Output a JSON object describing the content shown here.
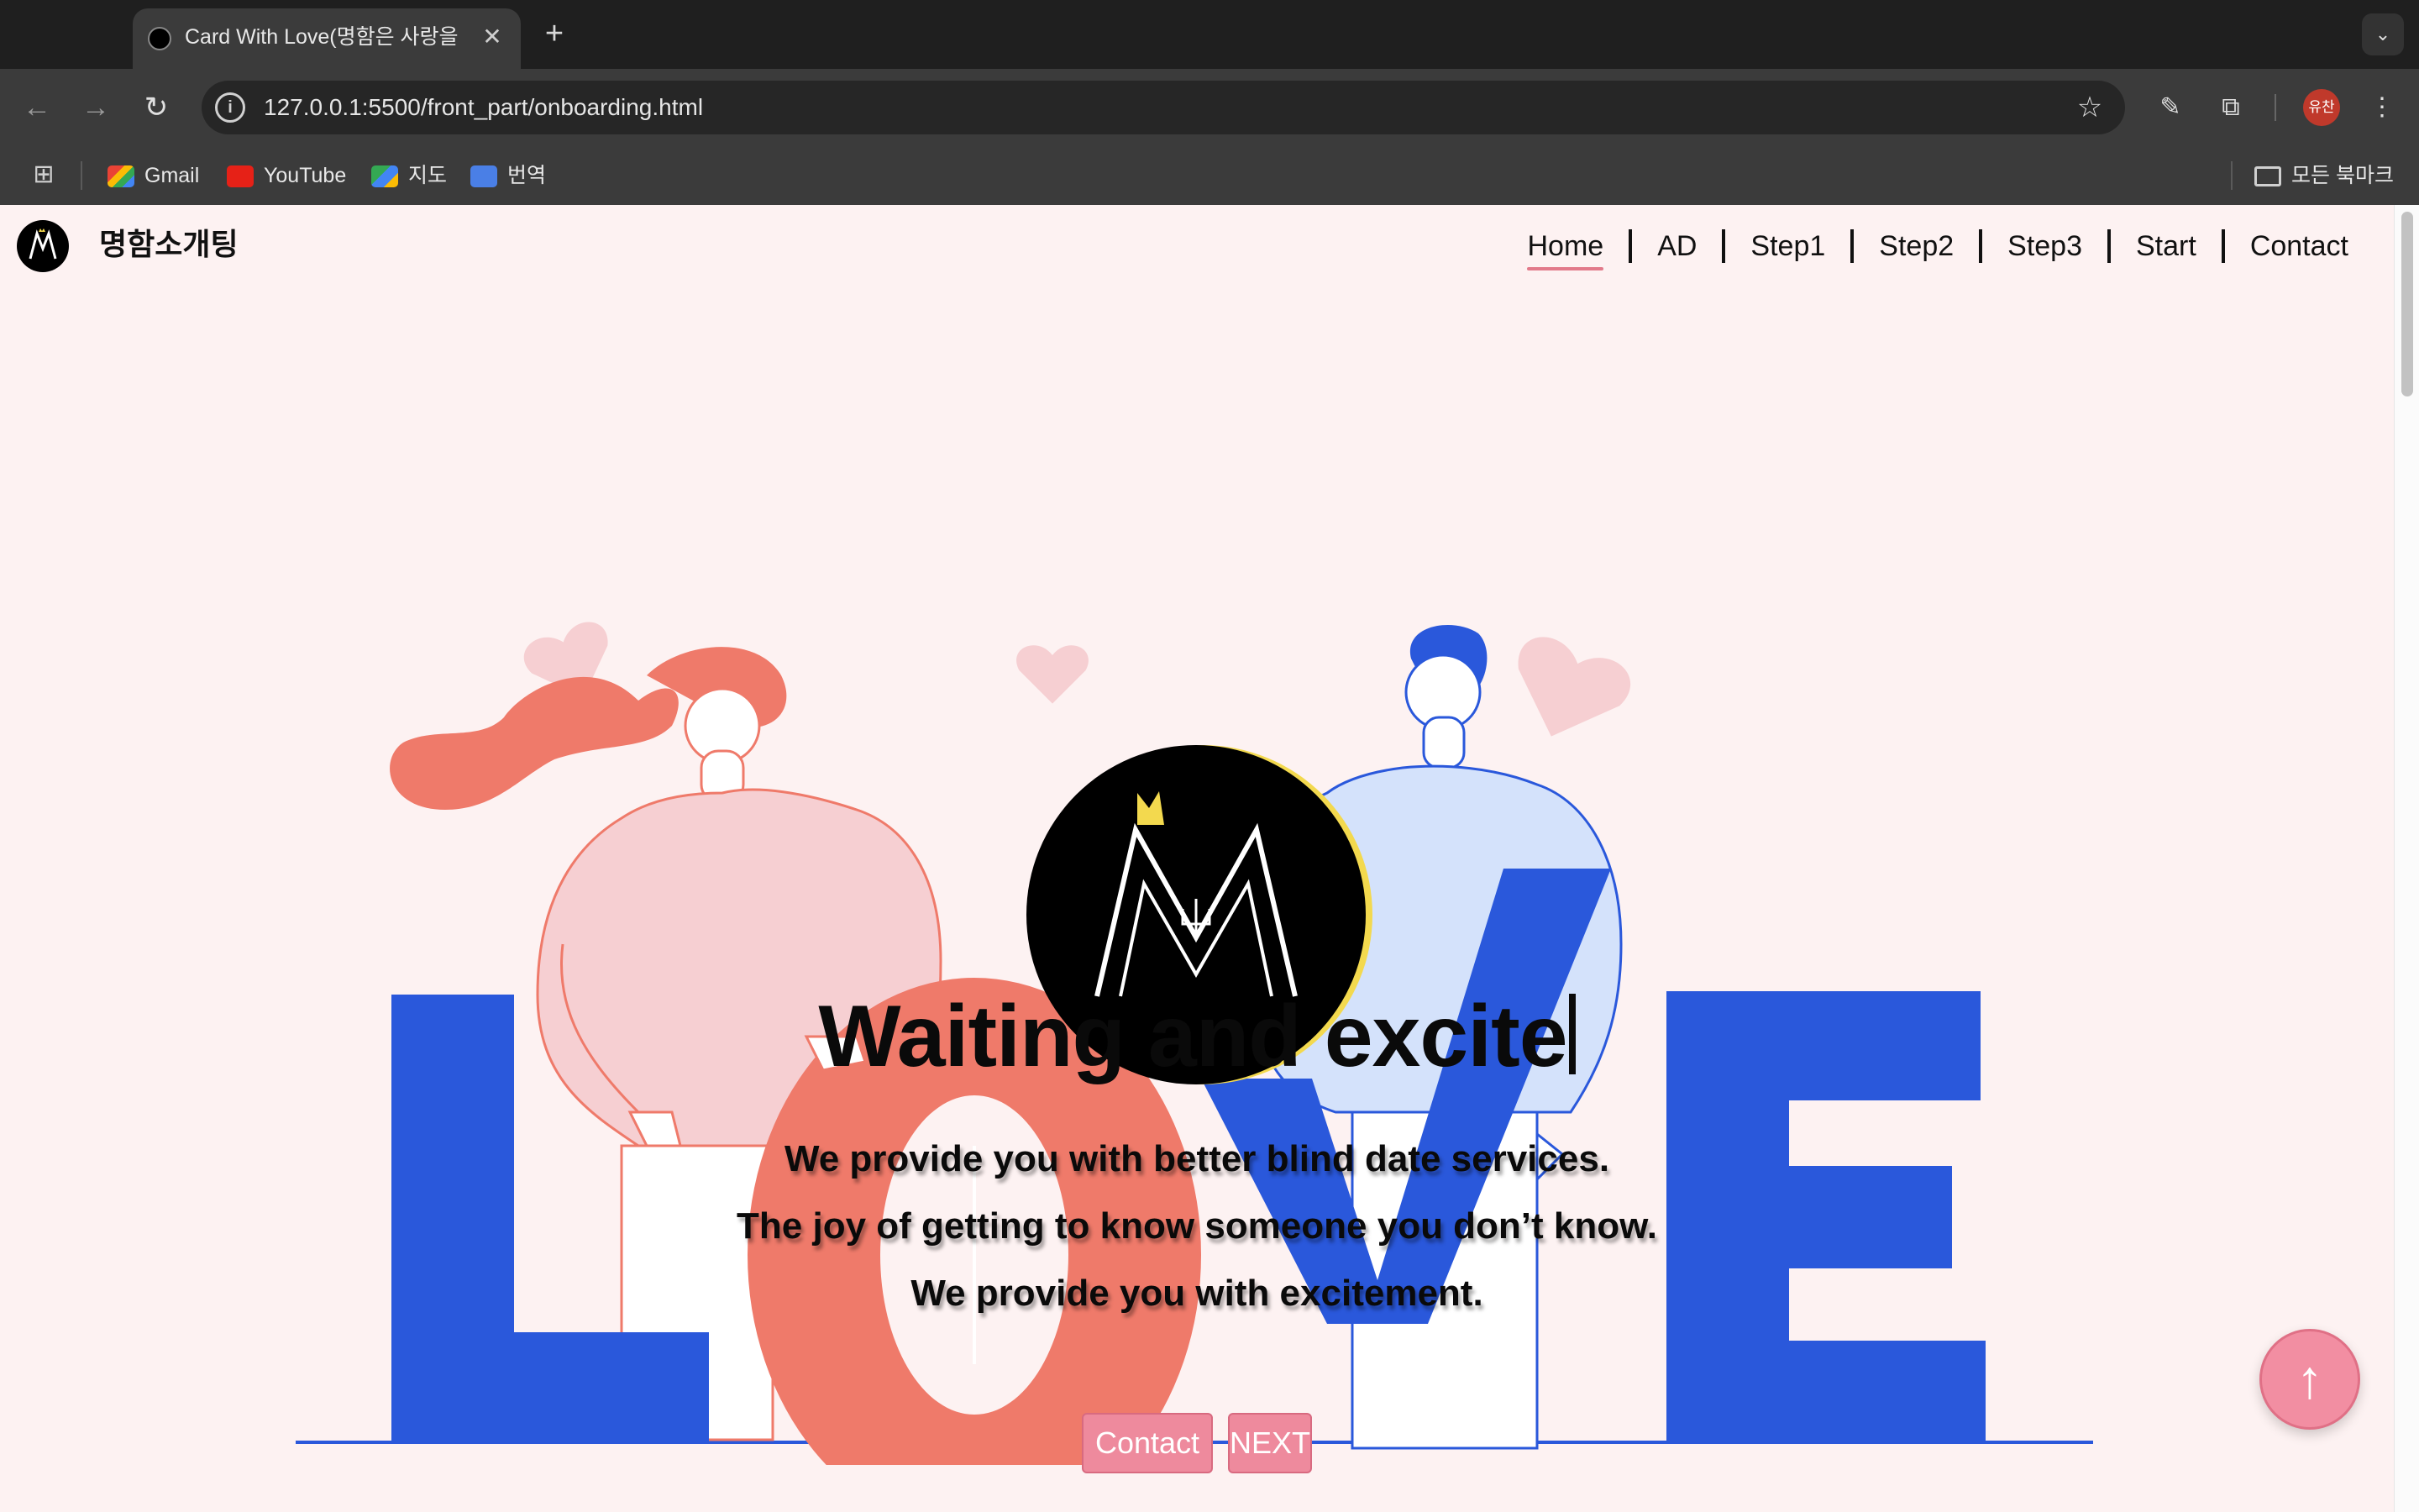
{
  "browser": {
    "tab_title": "Card With Love(명함은 사랑을 실",
    "url": "127.0.0.1:5500/front_part/onboarding.html",
    "bookmarks": [
      {
        "label": "Gmail",
        "icon": "gmail-icon"
      },
      {
        "label": "YouTube",
        "icon": "youtube-icon"
      },
      {
        "label": "지도",
        "icon": "maps-icon"
      },
      {
        "label": "번역",
        "icon": "translate-icon"
      }
    ],
    "all_bookmarks": "모든 북마크",
    "profile_initials": "유찬"
  },
  "header": {
    "brand": "명함소개팅",
    "nav": [
      "Home",
      "AD",
      "Step1",
      "Step2",
      "Step3",
      "Start",
      "Contact"
    ],
    "active": "Home"
  },
  "hero": {
    "headline": "Waiting and excite",
    "lines": [
      "We provide you with better blind date services.",
      "The joy of getting to know someone you don’t know.",
      "We provide you with excitement."
    ],
    "buttons": {
      "contact": "Contact",
      "next": "NEXT"
    },
    "colors": {
      "blue": "#2a58db",
      "coral": "#ef7a6a",
      "pink": "#f6cfd2",
      "light_blue": "#d4e2fb",
      "accent": "#ee8a9d",
      "crown": "#f3d94e"
    }
  }
}
